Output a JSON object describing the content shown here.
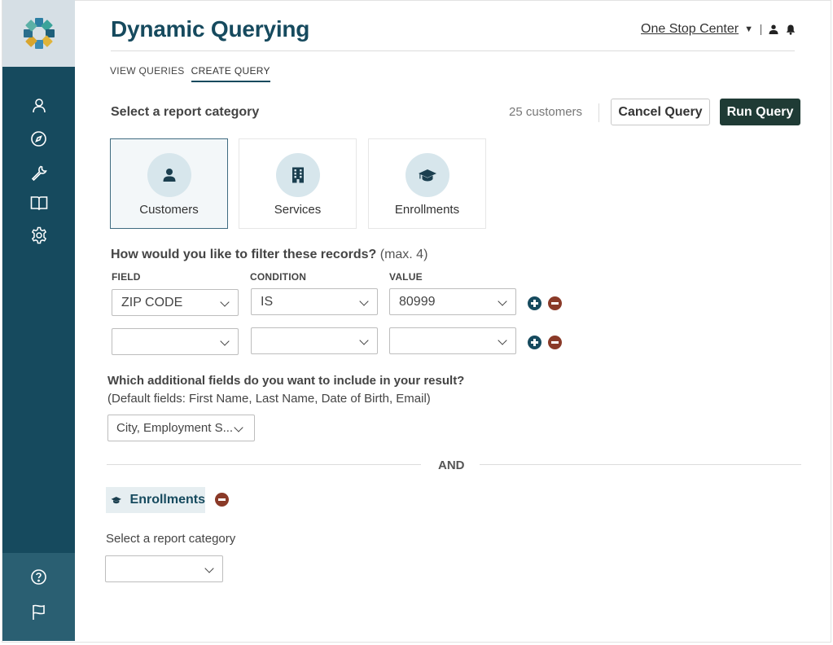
{
  "app": {
    "title": "Dynamic Querying",
    "center_name": "One Stop Center",
    "caret": "▼"
  },
  "sidebar": {
    "logo": "colorful-ring-logo",
    "items": [
      {
        "name": "user-icon"
      },
      {
        "name": "compass-icon"
      },
      {
        "name": "wrench-icon"
      },
      {
        "name": "book-icon"
      },
      {
        "name": "gear-icon"
      }
    ],
    "bottom_items": [
      {
        "name": "help-icon"
      },
      {
        "name": "flag-icon"
      }
    ]
  },
  "tabs": [
    {
      "label": "VIEW QUERIES",
      "active": false
    },
    {
      "label": "CREATE QUERY",
      "active": true
    }
  ],
  "category": {
    "label": "Select a report category",
    "count_text": "25 customers",
    "cancel_label": "Cancel Query",
    "run_label": "Run Query",
    "cards": [
      {
        "label": "Customers",
        "icon": "person-icon",
        "selected": true
      },
      {
        "label": "Services",
        "icon": "building-icon",
        "selected": false
      },
      {
        "label": "Enrollments",
        "icon": "graduation-cap-icon",
        "selected": false
      }
    ]
  },
  "filters": {
    "question": "How would you like to filter these records?",
    "max_note": "(max. 4)",
    "field_head": "FIELD",
    "condition_head": "CONDITION",
    "value_head": "VALUE",
    "rows": [
      {
        "field": "ZIP CODE",
        "condition": "IS",
        "value": "80999"
      },
      {
        "field": "",
        "condition": "",
        "value": ""
      }
    ]
  },
  "additional": {
    "question": "Which additional fields do you want to include in your result?",
    "defaults": "(Default fields: First Name, Last Name, Date of Birth, Email)",
    "selected": "City, Employment S..."
  },
  "and_label": "AND",
  "second_query": {
    "pill_label": "Enrollments",
    "category_label": "Select a report category",
    "category_value": ""
  },
  "colors": {
    "sidebar": "#164a5e",
    "accent": "#164a5e",
    "run_button": "#1f3b35",
    "remove": "#8a3a28",
    "card_circle": "#d7e6ec"
  }
}
